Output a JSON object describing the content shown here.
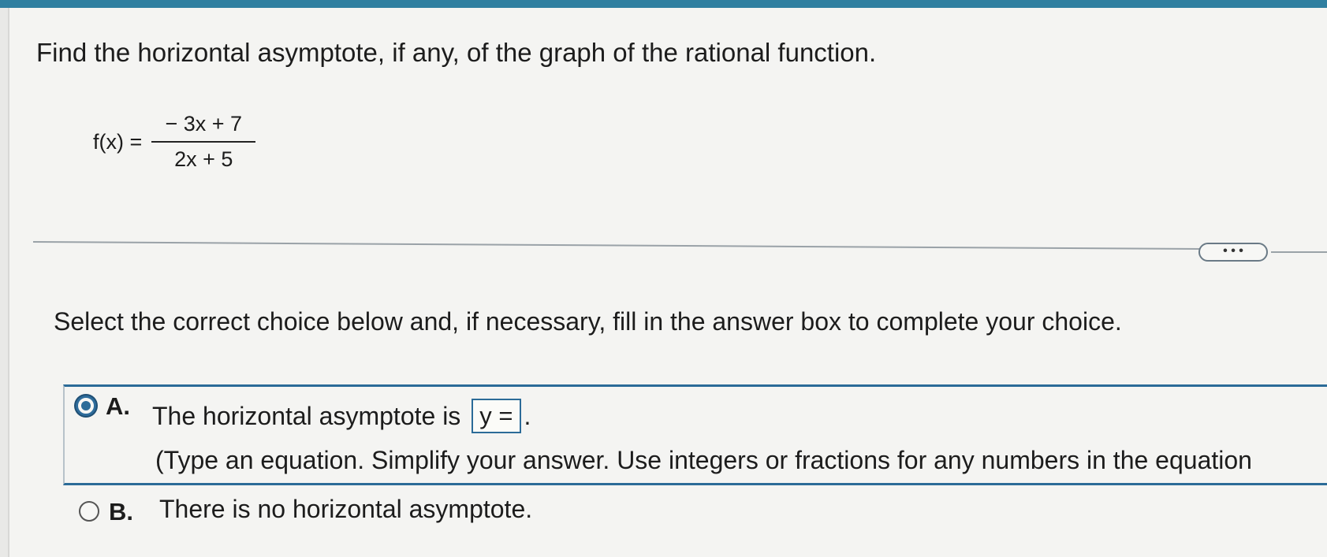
{
  "question": {
    "text": "Find the horizontal asymptote, if any, of the graph of the rational function."
  },
  "formula": {
    "lhs": "f(x) =",
    "numerator": "− 3x + 7",
    "denominator": "2x + 5"
  },
  "more_button": {
    "label": "• • •"
  },
  "instruction": {
    "text": "Select the correct choice below and, if necessary, fill in the answer box to complete your choice."
  },
  "choices": [
    {
      "letter": "A.",
      "selected": true,
      "text_before": "The horizontal asymptote is",
      "answer_value": "y =",
      "text_after": ".",
      "hint": "(Type an equation. Simplify your answer. Use integers or fractions for any numbers in the equation"
    },
    {
      "letter": "B.",
      "selected": false,
      "text": "There is no horizontal asymptote."
    }
  ],
  "colors": {
    "accent": "#2b6b98",
    "top_bar": "#2f7fa0",
    "background": "#f4f4f2",
    "text": "#1c1c1c"
  }
}
